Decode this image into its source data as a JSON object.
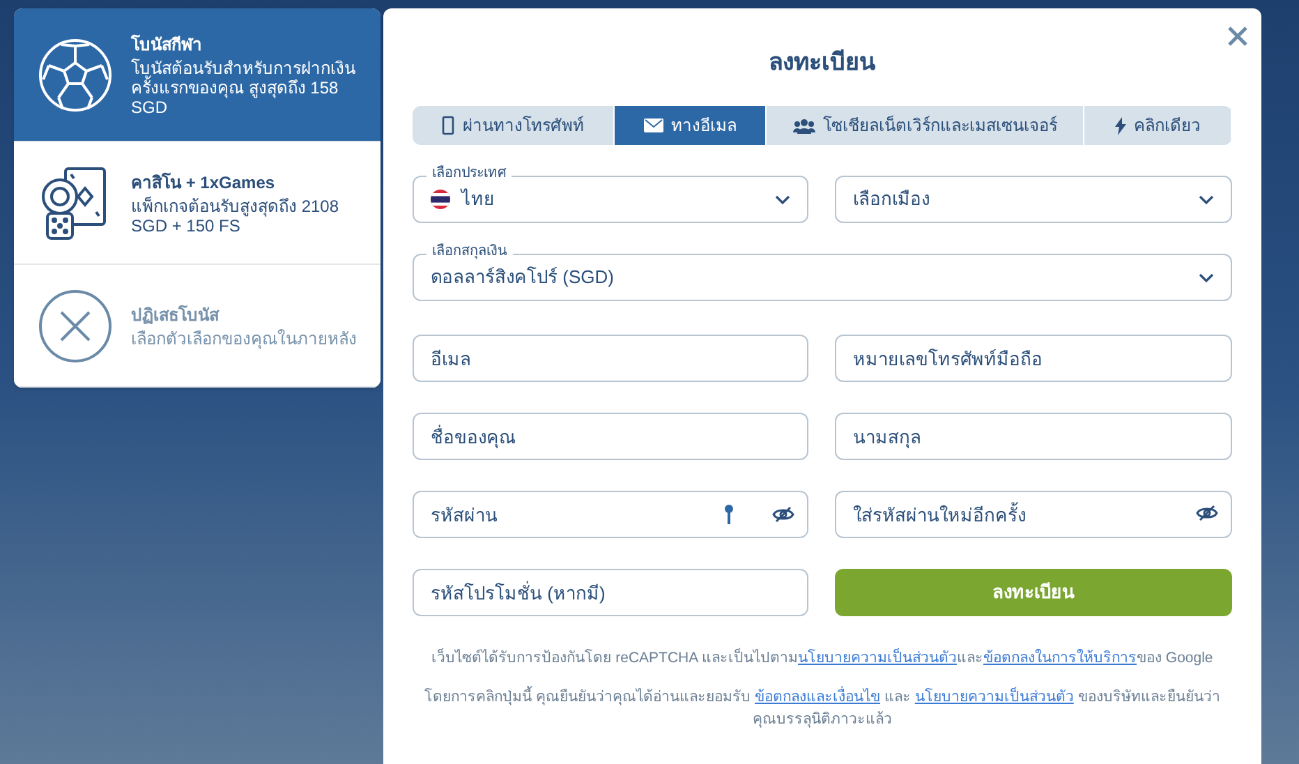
{
  "bonuses": [
    {
      "kind": "sport",
      "title": "โบนัสกีฬา",
      "description": "โบนัสต้อนรับสำหรับการฝากเงินครั้งแรกของคุณ สูงสุดถึง 158 SGD",
      "selected": true
    },
    {
      "kind": "casino",
      "title": "คาสิโน + 1xGames",
      "description": "แพ็กเกจต้อนรับสูงสุดถึง 2108 SGD + 150 FS",
      "selected": false
    },
    {
      "kind": "decline",
      "title": "ปฏิเสธโบนัส",
      "description": "เลือกตัวเลือกของคุณในภายหลัง",
      "selected": false
    }
  ],
  "modal": {
    "title": "ลงทะเบียน",
    "tabs": [
      {
        "kind": "phone",
        "label": "ผ่านทางโทรศัพท์",
        "selected": false
      },
      {
        "kind": "email",
        "label": "ทางอีเมล",
        "selected": true
      },
      {
        "kind": "social",
        "label": "โซเชียลเน็ตเวิร์กและเมสเซนเจอร์",
        "selected": false
      },
      {
        "kind": "oneclick",
        "label": "คลิกเดียว",
        "selected": false
      }
    ],
    "country": {
      "label": "เลือกประเทศ",
      "value": "ไทย"
    },
    "city": {
      "placeholder": "เลือกเมือง"
    },
    "currency": {
      "label": "เลือกสกุลเงิน",
      "value": "ดอลลาร์สิงคโปร์ (SGD)"
    },
    "fields": [
      {
        "kind": "text",
        "placeholder": "อีเมล"
      },
      {
        "kind": "text",
        "placeholder": "หมายเลขโทรศัพท์มือถือ"
      },
      {
        "kind": "text",
        "placeholder": "ชื่อของคุณ"
      },
      {
        "kind": "text",
        "placeholder": "นามสกุล"
      },
      {
        "kind": "password",
        "placeholder": "รหัสผ่าน",
        "generator": true
      },
      {
        "kind": "password",
        "placeholder": "ใส่รหัสผ่านใหม่อีกครั้ง",
        "generator": false
      },
      {
        "kind": "text",
        "placeholder": "รหัสโปรโมชั่น (หากมี)"
      }
    ],
    "submit": "ลงทะเบียน",
    "notices": [
      [
        {
          "text": "เว็บไซต์ได้รับการป้องกันโดย reCAPTCHA และเป็นไปตาม"
        },
        {
          "link": "นโยบายความเป็นส่วนตัว"
        },
        {
          "text": "และ"
        },
        {
          "link": "ข้อตกลงในการให้บริการ"
        },
        {
          "text": "ของ Google"
        }
      ],
      [
        {
          "text": "โดยการคลิกปุ่มนี้ คุณยืนยันว่าคุณได้อ่านและยอมรับ "
        },
        {
          "link": "ข้อตกลงและเงื่อนไข"
        },
        {
          "text": " และ "
        },
        {
          "link": "นโยบายความเป็นส่วนตัว"
        },
        {
          "text": " ของบริษัทและยืนยันว่าคุณบรรลุนิติภาวะแล้ว"
        }
      ]
    ]
  }
}
